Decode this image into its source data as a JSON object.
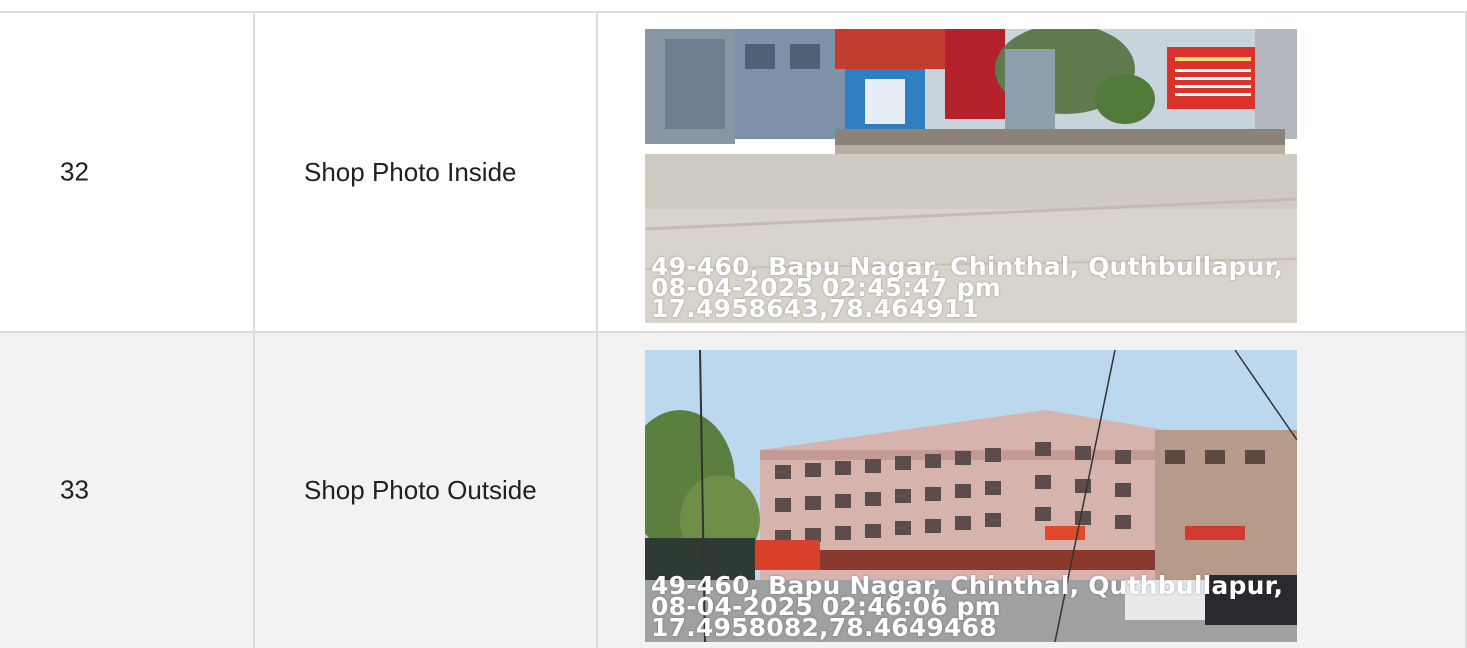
{
  "rows": [
    {
      "number": "32",
      "label": "Shop Photo Inside",
      "photo": {
        "address": "49-460, Bapu Nagar, Chinthal, Quthbullapur,",
        "datetime": "08-04-2025 02:45:47 pm",
        "coords": "17.4958643,78.464911"
      }
    },
    {
      "number": "33",
      "label": "Shop Photo Outside",
      "photo": {
        "address": "49-460, Bapu Nagar, Chinthal, Quthbullapur,",
        "datetime": "08-04-2025 02:46:06 pm",
        "coords": "17.4958082,78.4649468"
      }
    }
  ]
}
